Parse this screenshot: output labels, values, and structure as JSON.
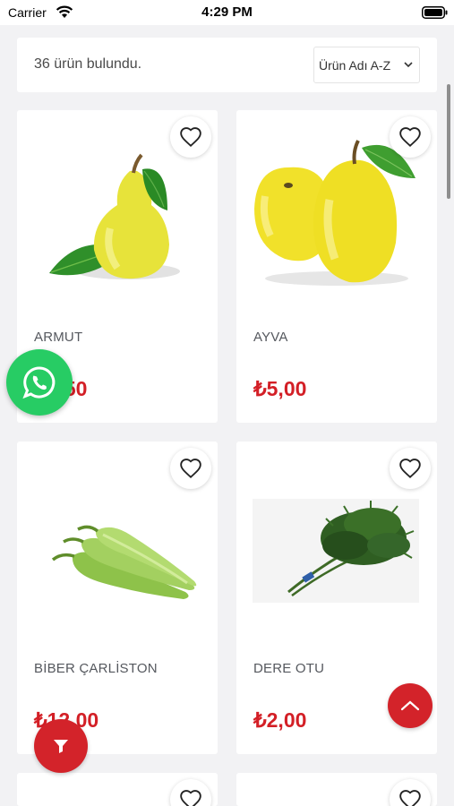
{
  "status_bar": {
    "carrier": "Carrier",
    "time": "4:29 PM"
  },
  "toolbar": {
    "result_count": "36 ürün bulundu.",
    "sort_selected": "Ürün Adı A-Z"
  },
  "products": [
    {
      "name": "ARMUT",
      "price": "₺5,50"
    },
    {
      "name": "AYVA",
      "price": "₺5,00"
    },
    {
      "name": "BİBER ÇARLİSTON",
      "price": "₺12,00"
    },
    {
      "name": "DERE OTU",
      "price": "₺2,00"
    }
  ],
  "icons": {
    "wifi": "wifi-icon",
    "battery": "battery-icon",
    "sort": "chevron-down-icon",
    "favorite": "heart-outline-icon",
    "whatsapp": "whatsapp-icon",
    "scroll_top": "chevron-up-icon",
    "filter": "filter-icon"
  },
  "colors": {
    "price": "#d31f26",
    "fab_red": "#d3232a",
    "whatsapp": "#27cc64"
  }
}
